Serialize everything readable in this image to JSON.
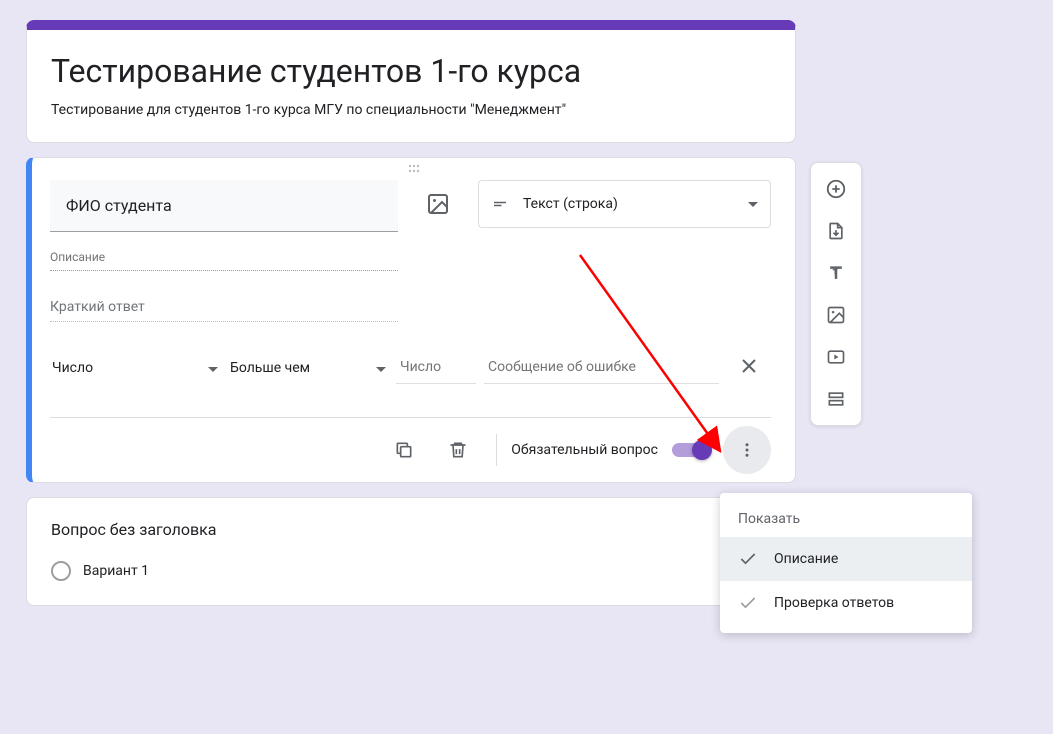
{
  "form": {
    "title": "Тестирование студентов 1-го курса",
    "description": "Тестирование для студентов 1-го курса МГУ по специальности \"Менеджмент\""
  },
  "question1": {
    "title": "ФИО студента",
    "desc_placeholder": "Описание",
    "answer_placeholder": "Краткий ответ",
    "type_label": "Текст (строка)",
    "validation": {
      "type": "Число",
      "condition": "Больше чем",
      "number_placeholder": "Число",
      "error_placeholder": "Сообщение об ошибке"
    },
    "required_label": "Обязательный вопрос"
  },
  "question2": {
    "title": "Вопрос без заголовка",
    "option1": "Вариант 1"
  },
  "popup": {
    "header": "Показать",
    "item1": "Описание",
    "item2": "Проверка ответов"
  }
}
